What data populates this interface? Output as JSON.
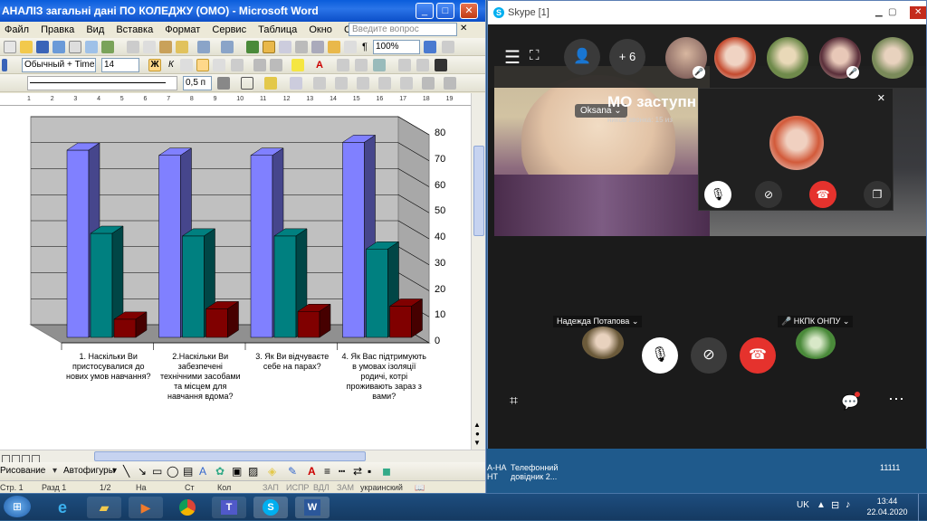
{
  "word": {
    "title": "АНАЛІЗ загальні дані ПО КОЛЕДЖУ (ОМО) - Microsoft Word",
    "menu": [
      "Файл",
      "Правка",
      "Вид",
      "Вставка",
      "Формат",
      "Сервис",
      "Таблица",
      "Окно",
      "Справка"
    ],
    "ask_placeholder": "Введите вопрос",
    "zoom": "100%",
    "style": "Обычный + Times",
    "font_size": "14",
    "line_width": "0,5 п",
    "draw_label": "Рисование",
    "autoshapes_label": "Автофигуры",
    "status": {
      "page": "Стр. 1",
      "section": "Разд 1",
      "pages": "1/2",
      "at": "На",
      "line": "Ст",
      "col": "Кол",
      "rec": "ЗАП",
      "trk": "ИСПР",
      "ext": "ВДЛ",
      "ovr": "ЗАМ",
      "lang": "украинский"
    },
    "ruler_marks": [
      "1",
      "2",
      "3",
      "4",
      "5",
      "6",
      "7",
      "8",
      "9",
      "10",
      "11",
      "12",
      "13",
      "14",
      "15",
      "16",
      "17",
      "18",
      "19"
    ]
  },
  "chart_data": {
    "type": "bar",
    "categories": [
      "1. Наскільки Ви пристосувалися до нових умов навчання?",
      "2.Наскільки Ви забезпечені технічними засобами та місцем для навчання вдома?",
      "3. Як Ви відчуваєте себе на парах?",
      "4. Як Вас підтримують в умовах ізоляції родичі, котрі проживають зараз з вами?"
    ],
    "series": [
      {
        "values": [
          72,
          70,
          70,
          75
        ],
        "color": "#8080ff"
      },
      {
        "values": [
          40,
          39,
          39,
          34
        ],
        "color": "#008080"
      },
      {
        "values": [
          7,
          11,
          10,
          12
        ],
        "color": "#800000"
      }
    ],
    "yticks": [
      "80",
      "70",
      "60",
      "50",
      "40",
      "30",
      "20",
      "10",
      "0"
    ],
    "ylim": [
      0,
      80
    ],
    "grid": true
  },
  "skype": {
    "title": "Skype [1]",
    "plus_count": "+ 6",
    "main_caller": "Oksana",
    "overlay_title": "МО заступн",
    "overlay_sub": "ников звонка: 15 из",
    "participant_left": "Надежда Потапова",
    "participant_right": "НКПК ОНПУ"
  },
  "taskbar": {
    "items": [
      "ie",
      "explorer",
      "media",
      "chrome",
      "teams",
      "skype",
      "word"
    ],
    "behind_text_1": "А-НА",
    "behind_text_2": "НТ",
    "behind_text_3": "Телефонний",
    "behind_text_4": "довідник 2...",
    "behind_num": "11111",
    "lang": "UK",
    "time": "13:44",
    "date": "22.04.2020"
  }
}
